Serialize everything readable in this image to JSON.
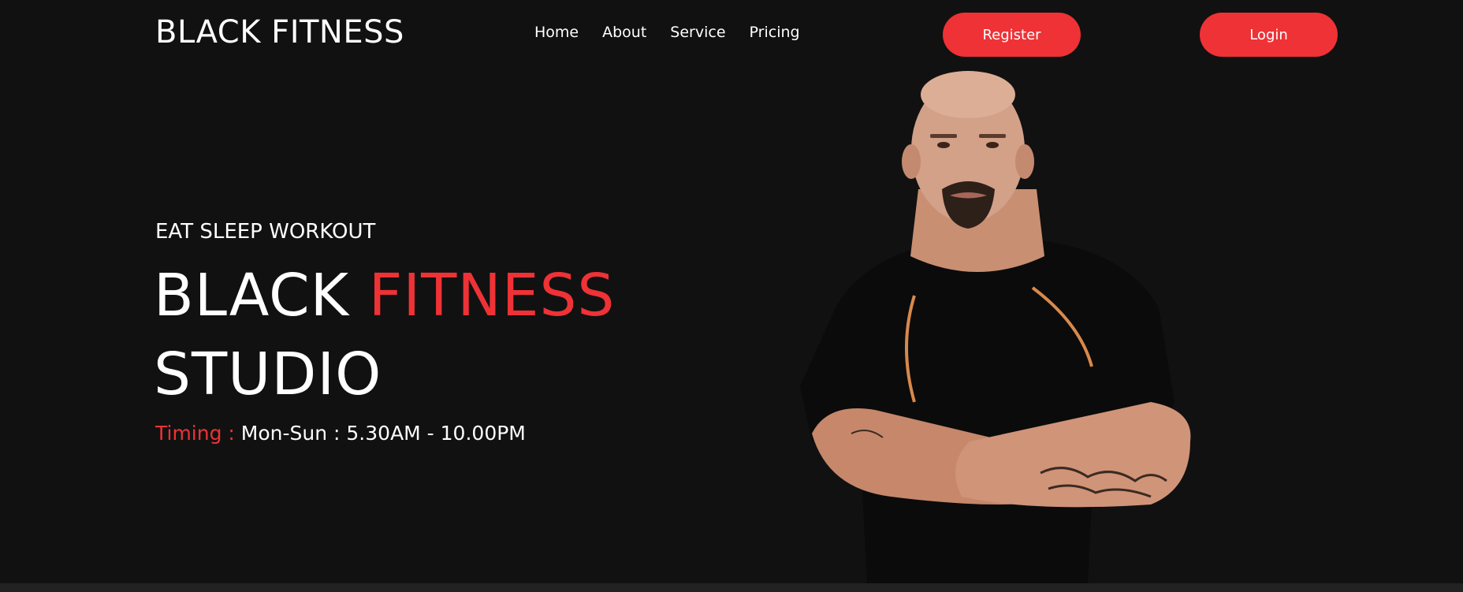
{
  "header": {
    "brand": "BLACK FITNESS",
    "nav": [
      {
        "label": "Home"
      },
      {
        "label": "About"
      },
      {
        "label": "Service"
      },
      {
        "label": "Pricing"
      }
    ],
    "register_label": "Register",
    "login_label": "Login"
  },
  "hero": {
    "tagline": "EAT SLEEP WORKOUT",
    "title_part1": "BLACK",
    "title_accent": "FITNESS",
    "title_line2": "STUDIO",
    "timing_label": "Timing :",
    "timing_value": "Mon-Sun : 5.30AM - 10.00PM"
  },
  "colors": {
    "background": "#111111",
    "accent": "#ee3236",
    "text": "#ffffff"
  }
}
